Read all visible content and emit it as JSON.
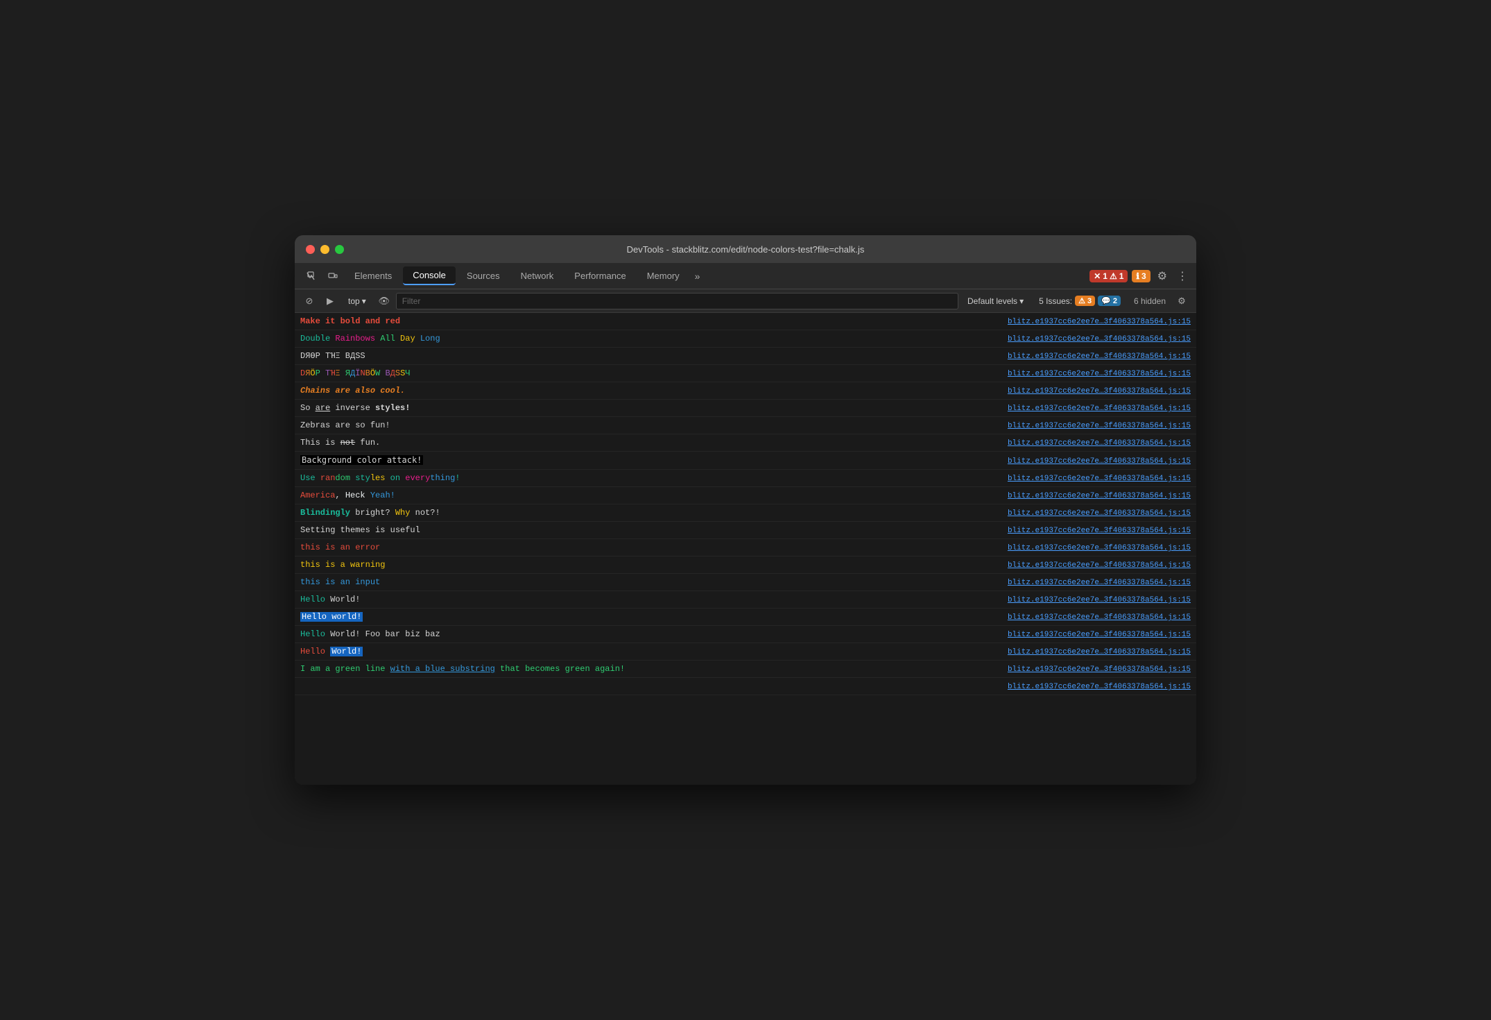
{
  "window": {
    "title": "DevTools - stackblitz.com/edit/node-colors-test?file=chalk.js"
  },
  "tabs": [
    {
      "label": "Elements",
      "active": false
    },
    {
      "label": "Console",
      "active": true
    },
    {
      "label": "Sources",
      "active": false
    },
    {
      "label": "Network",
      "active": false
    },
    {
      "label": "Performance",
      "active": false
    },
    {
      "label": "Memory",
      "active": false
    }
  ],
  "toolbar": {
    "top_label": "top",
    "filter_placeholder": "Filter",
    "levels_label": "Default levels",
    "issues_label": "5 Issues:",
    "issues_warn_count": "3",
    "issues_msg_count": "2",
    "hidden_label": "6 hidden"
  },
  "badges": {
    "error_count": "1",
    "warn_count": "1",
    "msg_count": "3"
  },
  "source": "blitz.e1937cc6e2ee7e…3f4063378a564.js:15",
  "console_rows": [
    {
      "id": 1,
      "type": "mixed"
    },
    {
      "id": 2,
      "type": "mixed"
    },
    {
      "id": 3,
      "type": "mixed"
    },
    {
      "id": 4,
      "type": "mixed"
    },
    {
      "id": 5,
      "type": "mixed"
    },
    {
      "id": 6,
      "type": "mixed"
    },
    {
      "id": 7,
      "type": "plain"
    },
    {
      "id": 8,
      "type": "plain"
    },
    {
      "id": 9,
      "type": "bg"
    },
    {
      "id": 10,
      "type": "mixed"
    },
    {
      "id": 11,
      "type": "mixed"
    },
    {
      "id": 12,
      "type": "mixed"
    },
    {
      "id": 13,
      "type": "plain"
    },
    {
      "id": 14,
      "type": "error"
    },
    {
      "id": 15,
      "type": "warning"
    },
    {
      "id": 16,
      "type": "input"
    },
    {
      "id": 17,
      "type": "plain"
    },
    {
      "id": 18,
      "type": "highlight"
    },
    {
      "id": 19,
      "type": "plain"
    },
    {
      "id": 20,
      "type": "mixed"
    },
    {
      "id": 21,
      "type": "mixed"
    },
    {
      "id": 22,
      "type": "plain"
    }
  ]
}
